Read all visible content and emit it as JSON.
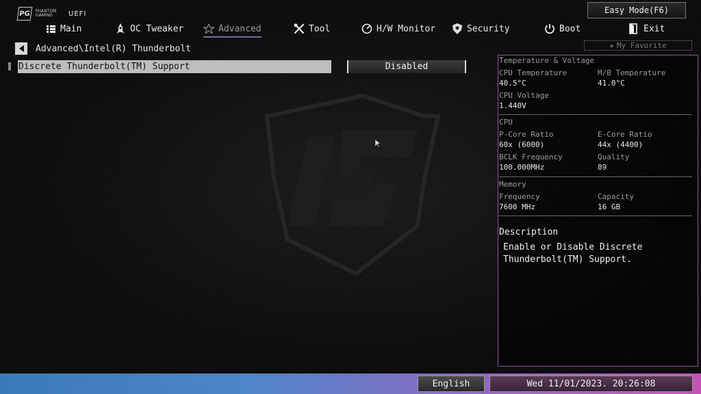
{
  "brand": {
    "logo_text": "PHANTOM GAMING",
    "uefi_label": "UEFI"
  },
  "easy_mode_label": "Easy Mode(F6)",
  "nav": [
    {
      "label": "Main",
      "icon": "list-icon",
      "active": false
    },
    {
      "label": "OC Tweaker",
      "icon": "rocket-icon",
      "active": false
    },
    {
      "label": "Advanced",
      "icon": "star-icon",
      "active": true
    },
    {
      "label": "Tool",
      "icon": "tools-icon",
      "active": false
    },
    {
      "label": "H/W Monitor",
      "icon": "monitor-icon",
      "active": false
    },
    {
      "label": "Security",
      "icon": "shield-icon",
      "active": false
    },
    {
      "label": "Boot",
      "icon": "power-icon",
      "active": false
    },
    {
      "label": "Exit",
      "icon": "exit-icon",
      "active": false
    }
  ],
  "breadcrumb": "Advanced\\Intel(R) Thunderbolt",
  "my_favorite_label": "My Favorite",
  "settings": [
    {
      "label": "Discrete Thunderbolt(TM) Support",
      "value": "Disabled"
    }
  ],
  "panel": {
    "temp_voltage": {
      "title": "Temperature & Voltage",
      "cpu_temp_label": "CPU Temperature",
      "cpu_temp_value": "40.5°C",
      "mb_temp_label": "M/B Temperature",
      "mb_temp_value": "41.0°C",
      "cpu_voltage_label": "CPU Voltage",
      "cpu_voltage_value": "1.440V"
    },
    "cpu": {
      "title": "CPU",
      "pcore_label": "P-Core Ratio",
      "pcore_value": "60x (6000)",
      "ecore_label": "E-Core Ratio",
      "ecore_value": "44x (4400)",
      "bclk_label": "BCLK Frequency",
      "bclk_value": "100.000MHz",
      "quality_label": "Quality",
      "quality_value": "89"
    },
    "memory": {
      "title": "Memory",
      "freq_label": "Frequency",
      "freq_value": "7600 MHz",
      "capacity_label": "Capacity",
      "capacity_value": "16 GB"
    },
    "description": {
      "title": "Description",
      "text": "Enable or Disable Discrete\nThunderbolt(TM) Support."
    }
  },
  "footer": {
    "language": "English",
    "datetime": "Wed 11/01/2023. 20:26:08"
  },
  "colors": {
    "panel_border": "#8c5aa0",
    "active_underline": "#6d6da8",
    "bar_left": "#3a7ab8",
    "bar_right": "#c454b8"
  }
}
